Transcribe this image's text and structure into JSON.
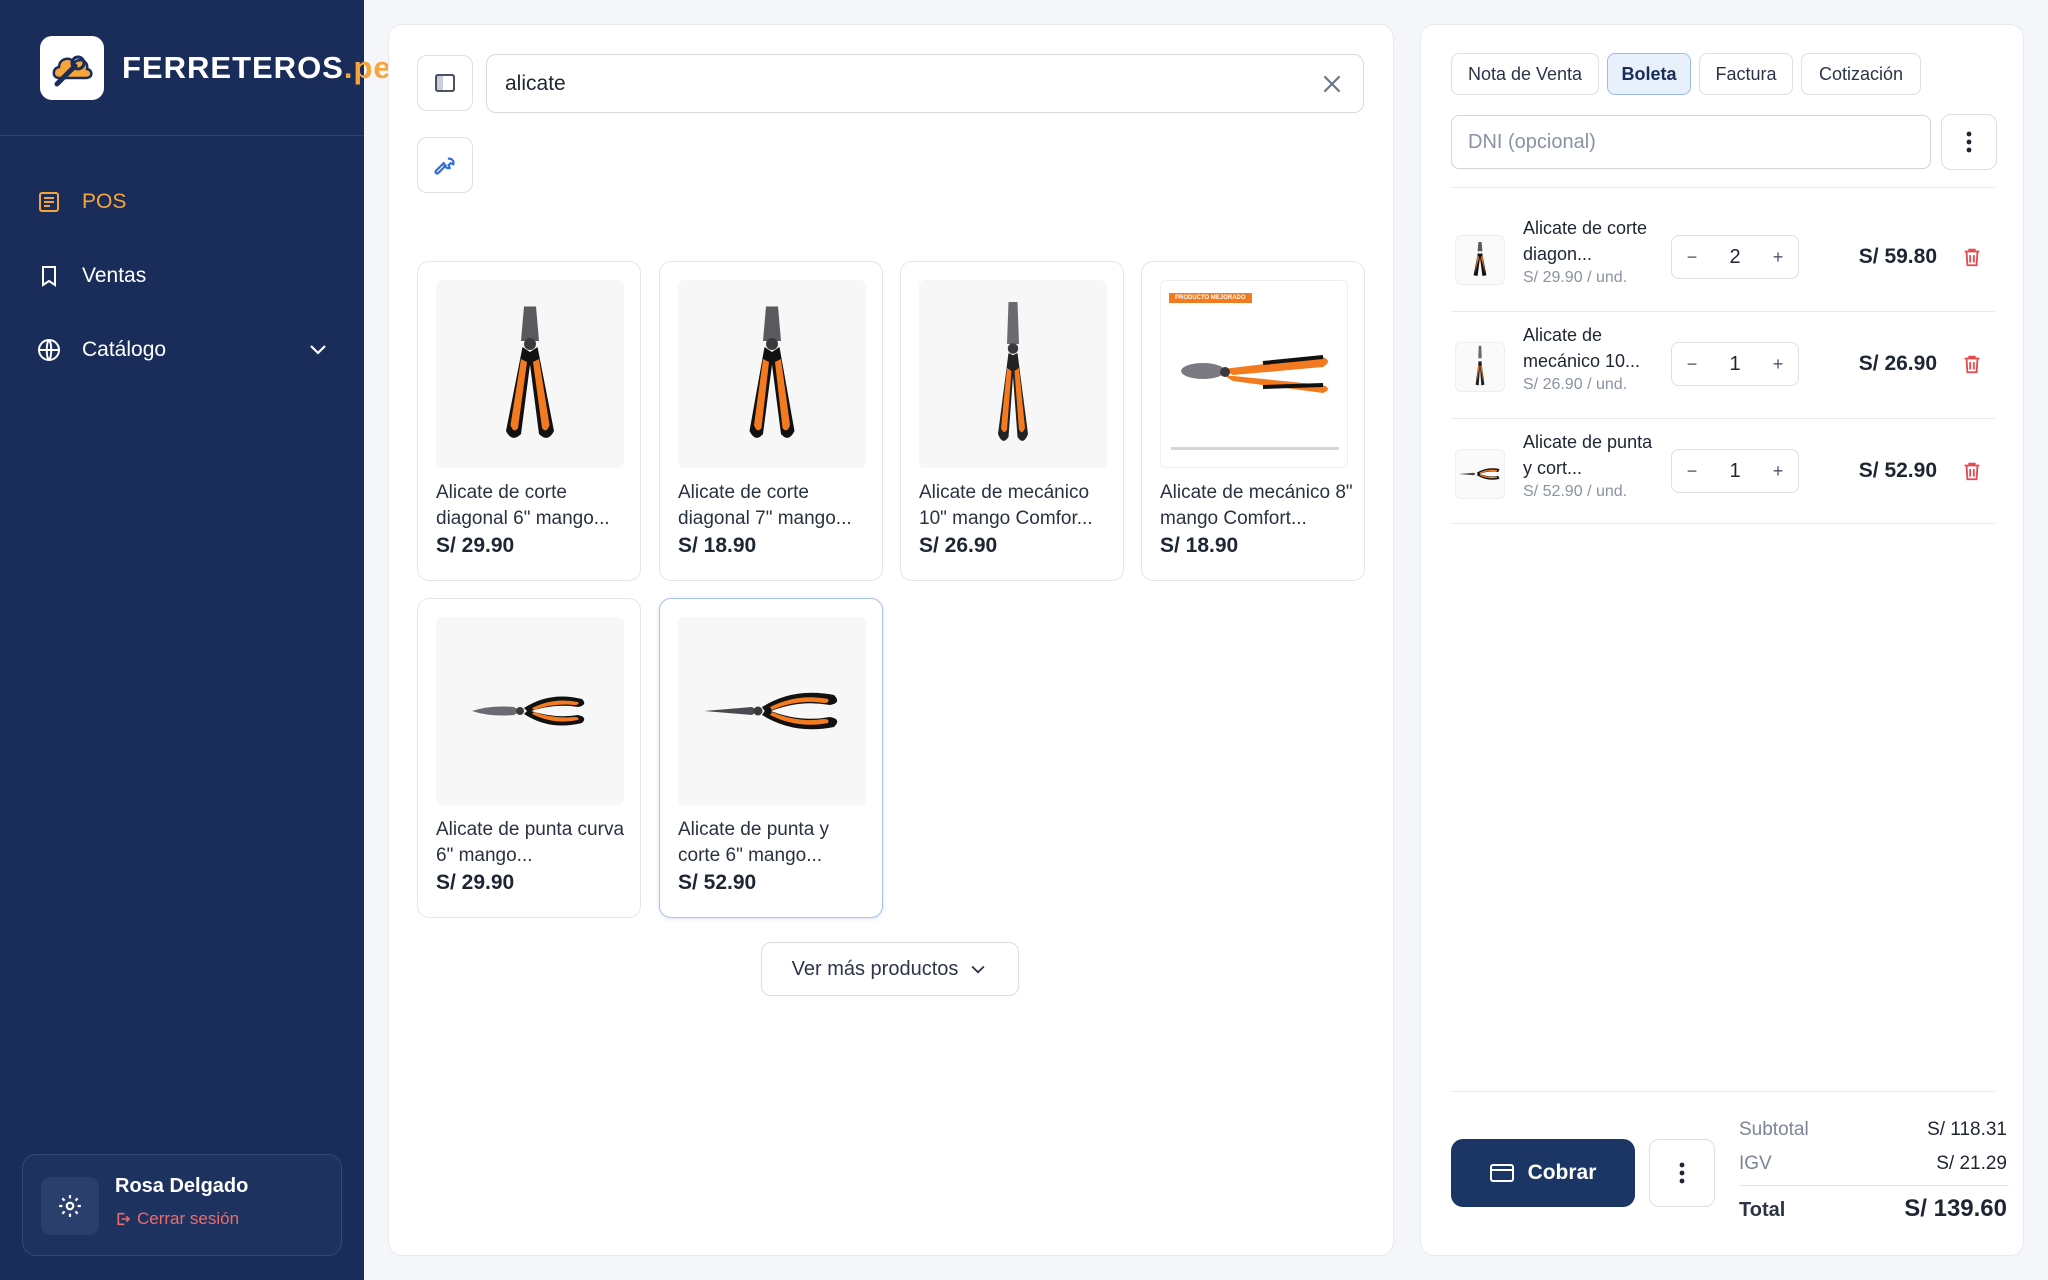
{
  "brand": {
    "name": "FERRETEROS",
    "tld": ".pe",
    "logo_icon": "wrench-cloud-icon"
  },
  "sidebar": {
    "items": [
      {
        "label": "POS",
        "icon": "receipt-icon",
        "active": true
      },
      {
        "label": "Ventas",
        "icon": "bookmark-icon",
        "active": false
      },
      {
        "label": "Catálogo",
        "icon": "globe-icon",
        "active": false
      }
    ],
    "user": {
      "name": "Rosa Delgado",
      "logout_label": "Cerrar sesión"
    }
  },
  "search": {
    "value": "alicate",
    "placeholder": ""
  },
  "products": [
    {
      "name": "Alicate de corte diagonal 6\" mango...",
      "price": "S/ 29.90",
      "image": "diagonal-pliers"
    },
    {
      "name": "Alicate de corte diagonal 7\" mango...",
      "price": "S/ 18.90",
      "image": "diagonal-pliers"
    },
    {
      "name": "Alicate de mecánico 10\" mango Comfor...",
      "price": "S/ 26.90",
      "image": "slip-joint-pliers"
    },
    {
      "name": "Alicate de mecánico 8\" mango Comfort...",
      "price": "S/ 18.90",
      "image": "slip-joint-pliers-banner",
      "badge": "PRODUCTO MEJORADO"
    },
    {
      "name": "Alicate de punta curva 6\" mango...",
      "price": "S/ 29.90",
      "image": "bent-nose-pliers"
    },
    {
      "name": "Alicate de punta y corte 6\" mango...",
      "price": "S/ 52.90",
      "image": "needle-nose-pliers",
      "selected": true
    }
  ],
  "more_button": {
    "label": "Ver más productos"
  },
  "doc_types": [
    {
      "label": "Nota de Venta",
      "active": false
    },
    {
      "label": "Boleta",
      "active": true
    },
    {
      "label": "Factura",
      "active": false
    },
    {
      "label": "Cotización",
      "active": false
    }
  ],
  "dni": {
    "placeholder": "DNI (opcional)",
    "value": ""
  },
  "cart": [
    {
      "name": "Alicate de corte diagon...",
      "unit_price": "S/ 29.90",
      "unit_suffix": "/ und.",
      "qty": "2",
      "total": "S/ 59.80"
    },
    {
      "name": "Alicate de mecánico 10...",
      "unit_price": "S/ 26.90",
      "unit_suffix": "/ und.",
      "qty": "1",
      "total": "S/ 26.90"
    },
    {
      "name": "Alicate de punta y cort...",
      "unit_price": "S/ 52.90",
      "unit_suffix": "/ und.",
      "qty": "1",
      "total": "S/ 52.90"
    }
  ],
  "summary": {
    "subtotal_label": "Subtotal",
    "subtotal": "S/ 118.31",
    "igv_label": "IGV",
    "igv": "S/ 21.29",
    "total_label": "Total",
    "total": "S/ 139.60"
  },
  "checkout": {
    "label": "Cobrar"
  },
  "colors": {
    "sidebar": "#1a2d5a",
    "accent": "#f5a53a",
    "primary": "#1b3565",
    "danger": "#e5484d",
    "tool_orange": "#f47a1f"
  }
}
